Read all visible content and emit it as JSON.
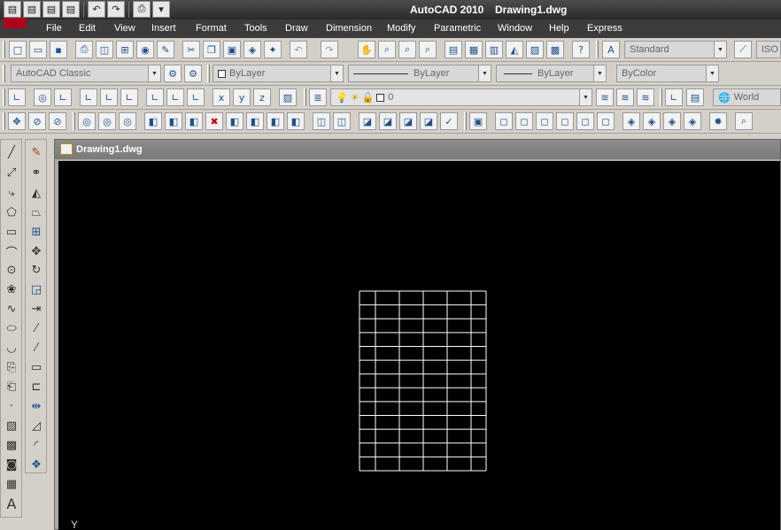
{
  "window": {
    "app_title": "AutoCAD 2010",
    "document_title": "Drawing1.dwg"
  },
  "menu": [
    "File",
    "Edit",
    "View",
    "Insert",
    "Format",
    "Tools",
    "Draw",
    "Dimension",
    "Modify",
    "Parametric",
    "Window",
    "Help",
    "Express"
  ],
  "toolbars": {
    "text_style": "Standard",
    "dim_style_partial": "ISO",
    "workspace": "AutoCAD Classic",
    "color": "ByLayer",
    "linetype": "ByLayer",
    "lineweight": "ByLayer",
    "plot_style": "ByColor",
    "layer": "0",
    "ucs": "World"
  },
  "drawing": {
    "tab_title": "Drawing1.dwg",
    "ucs_axis_label": "Y",
    "grid_columns": 5,
    "grid_rows": 12,
    "colors": {
      "canvas": "#000000",
      "lines": "#ffffff"
    }
  }
}
